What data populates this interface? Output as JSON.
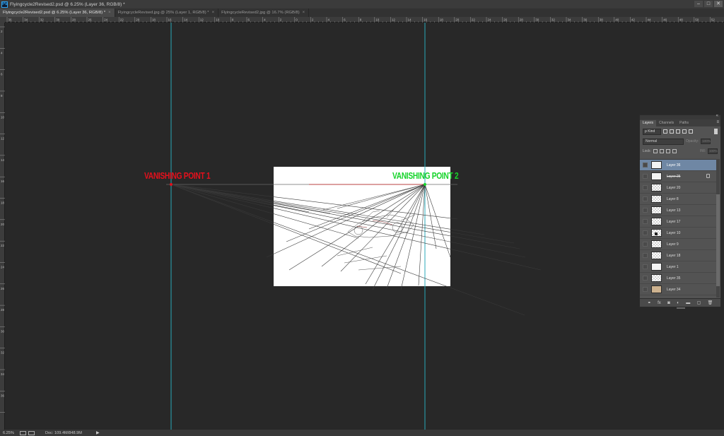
{
  "window": {
    "app_logo": "Ps",
    "title": "Flyingcycle2Revised2.psd @ 6.25% (Layer 36, RGB/8) *",
    "controls": [
      "–",
      "□",
      "✕"
    ]
  },
  "tabs": [
    {
      "label": "Flyingcycle2Revised2.psd @ 6.25% (Layer 36, RGB/8) *",
      "active": true
    },
    {
      "label": "FlyingcycleRevised.jpg @ 25% (Layer 1, RGB/8) *",
      "active": false
    },
    {
      "label": "FlyingcycleRevised2.jpg @ 16.7% (RGB/8)",
      "active": false
    }
  ],
  "ruler_top_labels": [
    "36",
    "34",
    "32",
    "30",
    "28",
    "26",
    "24",
    "22",
    "20",
    "18",
    "16",
    "14",
    "12",
    "10",
    "8",
    "6",
    "4",
    "2",
    "0",
    "2",
    "4",
    "6",
    "8",
    "10",
    "12",
    "14",
    "16",
    "18",
    "20",
    "22",
    "24",
    "26",
    "28",
    "30",
    "32",
    "34",
    "36",
    "38",
    "40",
    "42",
    "44",
    "46",
    "48",
    "50",
    "52"
  ],
  "ruler_left_labels": [
    "2",
    "4",
    "6",
    "8",
    "10",
    "12",
    "14",
    "16",
    "18",
    "20",
    "22",
    "24",
    "26",
    "28",
    "30",
    "32",
    "34",
    "36"
  ],
  "canvas": {
    "vanishing_point_1": "VANISHING POINT 1",
    "vanishing_point_2": "VANISHING POINT 2",
    "vp1_color": "#e3101c",
    "vp2_color": "#16d42a",
    "guide_color": "#29a8b8",
    "document_background": "#ffffff"
  },
  "status": {
    "zoom": "6.25%",
    "doc": "Doc: 109.4M/848.9M",
    "arrow": "▶"
  },
  "layers_panel": {
    "collapse_icon": "«",
    "tabs": [
      "Layers",
      "Channels",
      "Paths"
    ],
    "menu_icon": "≡",
    "filter_label": "ρ Kind",
    "blend_mode": "Normal",
    "opacity_label": "Opacity:",
    "opacity_value": "100%",
    "lock_label": "Lock:",
    "fill_label": "Fill:",
    "fill_value": "100%",
    "layers": [
      {
        "name": "Layer 36",
        "selected": true,
        "thumb": "sketch"
      },
      {
        "name": "Layer 25",
        "strikethrough": true,
        "locked": true,
        "thumb": "sketch"
      },
      {
        "name": "Layer 20",
        "thumb": "checker"
      },
      {
        "name": "Layer 8",
        "thumb": "checker"
      },
      {
        "name": "Layer 13",
        "thumb": "checker"
      },
      {
        "name": "Layer 17",
        "thumb": "checker"
      },
      {
        "name": "Layer 10",
        "thumb": "mark"
      },
      {
        "name": "Layer 9",
        "thumb": "checker"
      },
      {
        "name": "Layer 18",
        "thumb": "checker"
      },
      {
        "name": "Layer 1",
        "thumb": "sketch"
      },
      {
        "name": "Layer 35",
        "thumb": "checker"
      },
      {
        "name": "Layer 34",
        "thumb": "tan"
      }
    ],
    "footer_icons": [
      "link-icon",
      "fx-icon",
      "mask-icon",
      "adjustment-icon",
      "folder-icon",
      "new-layer-icon",
      "trash-icon"
    ],
    "footer_glyphs": [
      "⚭",
      "fx",
      "◙",
      "◐",
      "▬",
      "▢",
      "🗑"
    ]
  }
}
